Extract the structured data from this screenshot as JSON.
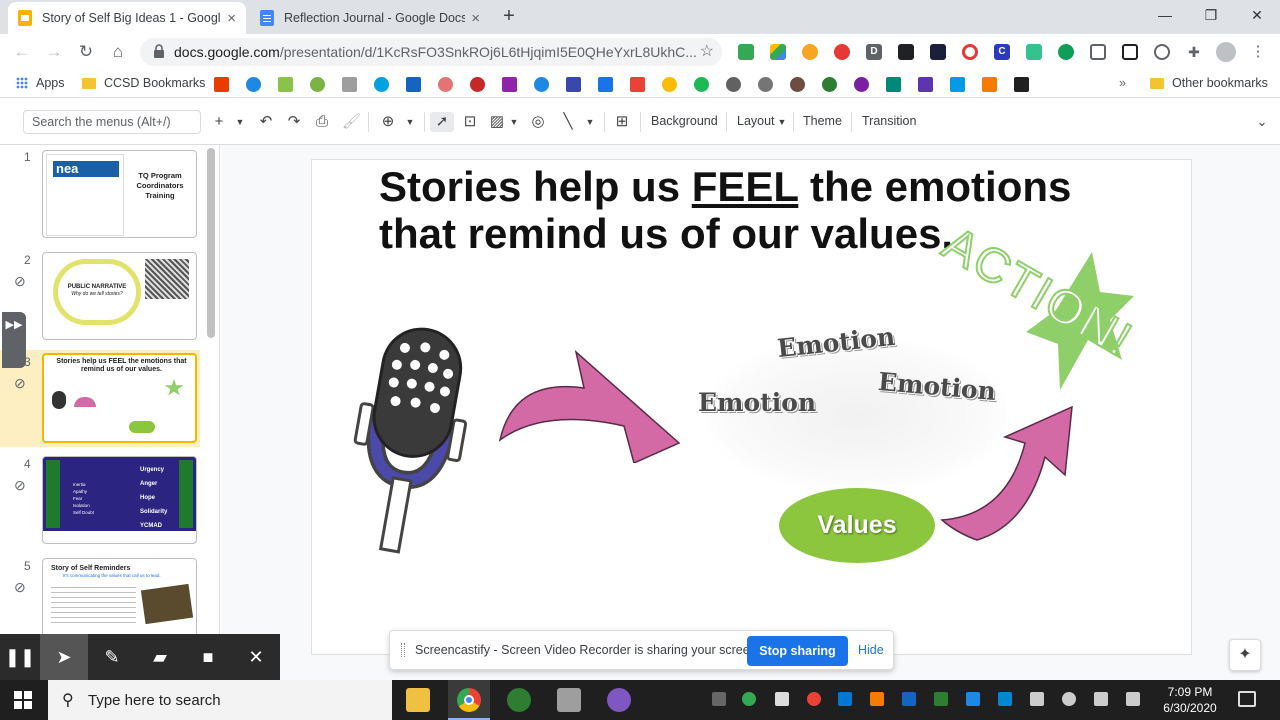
{
  "browser": {
    "tabs": [
      {
        "title": "Story of Self Big Ideas 1 - Google",
        "close": "×",
        "active": true
      },
      {
        "title": "Reflection Journal - Google Docs",
        "close": "×",
        "active": false
      }
    ],
    "new_tab": "+",
    "window_controls": {
      "minimize": "—",
      "restore": "❐",
      "close": "✕"
    },
    "url_host": "docs.google.com",
    "url_path": "/presentation/d/1KcRsFO3SnkROj6L6tHjqimI5E0QHeYxrL8UkhC...",
    "bookmarks": {
      "apps": "Apps",
      "ccsd": "CCSD Bookmarks",
      "more": "»",
      "other": "Other bookmarks"
    }
  },
  "slides_toolbar": {
    "search_placeholder": "Search the menus (Alt+/)",
    "background": "Background",
    "layout": "Layout",
    "theme": "Theme",
    "transition": "Transition"
  },
  "filmstrip": {
    "slides": [
      {
        "num": "1",
        "title": "TQ Program Coordinators Training",
        "org": "nea"
      },
      {
        "num": "2",
        "title": "PUBLIC NARRATIVE",
        "subtitle": "Why do we tell stories?"
      },
      {
        "num": "3",
        "title": "Stories help us FEEL the emotions that remind us of our values."
      },
      {
        "num": "4",
        "left": "STAGNATION",
        "right": "MOTIVATION",
        "items": [
          "Urgency",
          "Anger",
          "Hope",
          "Solidarity",
          "YCMAD"
        ],
        "inertia": [
          "Inertia",
          "Apathy",
          "Fear",
          "Isolation",
          "Self Doubt"
        ]
      },
      {
        "num": "5",
        "title": "Story of Self Reminders",
        "subtitle": "It's communicating the values that call us to lead."
      }
    ]
  },
  "slide": {
    "title_pre": "Stories help us ",
    "title_underlined": "FEEL",
    "title_post": " the emotions\nthat remind us of our values.",
    "emotion_1": "Emotion",
    "emotion_2": "Emotion",
    "emotion_3": "Emotion",
    "values": "Values",
    "action": "ACTION!"
  },
  "screencastify": {
    "message": "Screencastify - Screen Video Recorder is sharing your screen.",
    "stop": "Stop sharing",
    "hide": "Hide"
  },
  "taskbar": {
    "search_placeholder": "Type here to search",
    "time": "7:09 PM",
    "date": "6/30/2020"
  },
  "colors": {
    "chrome_tabstrip": "#dee1e6",
    "accent_blue": "#1a73e8",
    "selected_slide": "#f6b400",
    "arrow_pink": "#d36aa6",
    "values_green": "#8cc63f",
    "action_green": "#8fcf6a",
    "mic_blue": "#4b4aa8"
  }
}
